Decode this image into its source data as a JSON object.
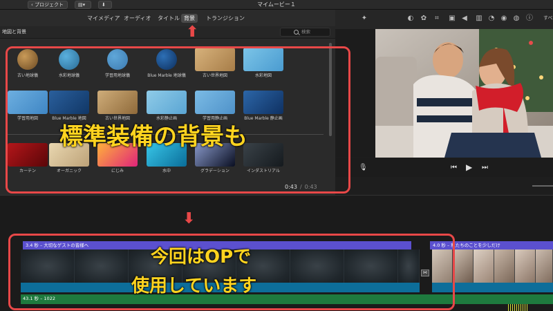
{
  "window": {
    "title": "マイムービー１",
    "back_button": "‹ プロジェクト"
  },
  "tabs": [
    {
      "label": "マイメディア",
      "active": false
    },
    {
      "label": "オーディオ",
      "active": false
    },
    {
      "label": "タイトル",
      "active": false
    },
    {
      "label": "背景",
      "active": true
    },
    {
      "label": "トランジション",
      "active": false
    }
  ],
  "browser": {
    "title": "地図と背景",
    "search_placeholder": "検索",
    "rows": [
      [
        {
          "label": "古い地球儀",
          "colors": [
            "#c99a58",
            "#6b4a23"
          ]
        },
        {
          "label": "水彩地球儀",
          "colors": [
            "#5ab0de",
            "#2a6b95"
          ]
        },
        {
          "label": "学習用地球儀",
          "colors": [
            "#5fa7d9",
            "#3d7ab0"
          ]
        },
        {
          "label": "Blue Marble 地球儀",
          "colors": [
            "#2d6fb5",
            "#0d2e5c"
          ]
        },
        {
          "label": "古い世界地図",
          "colors": [
            "#d7b27c",
            "#a77d48"
          ]
        },
        {
          "label": "水彩地図",
          "colors": [
            "#7cc5e8",
            "#4a9bd0"
          ]
        }
      ],
      [
        {
          "label": "学習用地図",
          "colors": [
            "#6dafe0",
            "#3f86c4"
          ]
        },
        {
          "label": "Blue Marble 地図",
          "colors": [
            "#2a5f9c",
            "#113766"
          ]
        },
        {
          "label": "古い世界地図",
          "colors": [
            "#cfad7a",
            "#8f6a3a"
          ]
        },
        {
          "label": "水彩静止画",
          "colors": [
            "#8fcbe8",
            "#5aa5d3"
          ]
        },
        {
          "label": "学習用静止画",
          "colors": [
            "#7bbbe5",
            "#4f92c9"
          ]
        },
        {
          "label": "Blue Marble 静止画",
          "colors": [
            "#2c66a8",
            "#0f3162"
          ]
        }
      ],
      [
        {
          "label": "カーテン",
          "colors": [
            "#b4161a",
            "#5a0608"
          ]
        },
        {
          "label": "オーガニック",
          "colors": [
            "#e9d7b0",
            "#bda278"
          ]
        },
        {
          "label": "にじみ",
          "colors": [
            "#ffb23a",
            "#e0247a"
          ]
        },
        {
          "label": "水中",
          "colors": [
            "#38c6e8",
            "#0a6d99"
          ]
        },
        {
          "label": "グラデーション",
          "colors": [
            "#8898c9",
            "#0a0f22"
          ]
        },
        {
          "label": "インダストリアル",
          "colors": [
            "#3a4248",
            "#151a1e"
          ]
        }
      ]
    ],
    "time_current": "0:43",
    "time_separator": "/",
    "time_total": "0:43"
  },
  "viewer": {
    "toolbar_icons": [
      "magic-wand-icon",
      "color-balance-icon",
      "color-palette-icon",
      "crop-icon",
      "stabilize-icon",
      "volume-icon",
      "equalizer-icon",
      "speed-icon",
      "noise-reduction-icon",
      "clip-filter-icon",
      "info-icon"
    ],
    "more_label": "すべ",
    "controls": {
      "mic": "🎙",
      "prev": "⏮",
      "play": "▶",
      "next": "⏭"
    }
  },
  "timeline": {
    "title_clip_1": "3.4 秒 – 大切なゲストの皆様へ",
    "title_clip_2": "4.0 秒 – 私たちのことを少しだけ",
    "audio_clip": "43.1 秒 – 1022",
    "transition_icon": "⋈"
  },
  "annotations": {
    "top_caption": "標準装備の背景も",
    "bottom_caption_line1": "今回はOPで",
    "bottom_caption_line2": "使用しています",
    "arrow_up": "⬆",
    "arrow_down": "⬇"
  }
}
